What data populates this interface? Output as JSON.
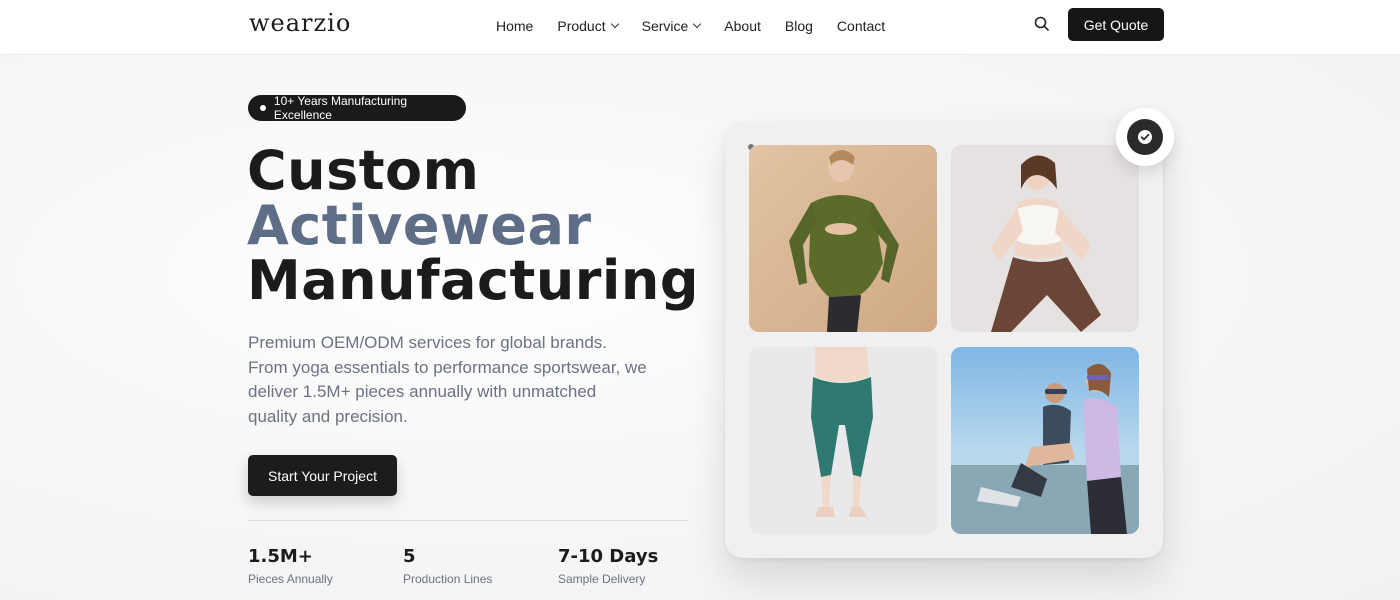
{
  "brand": {
    "logo_text": "wearzio"
  },
  "nav": {
    "items": [
      {
        "label": "Home",
        "has_dropdown": false
      },
      {
        "label": "Product",
        "has_dropdown": true
      },
      {
        "label": "Service",
        "has_dropdown": true
      },
      {
        "label": "About",
        "has_dropdown": false
      },
      {
        "label": "Blog",
        "has_dropdown": false
      },
      {
        "label": "Contact",
        "has_dropdown": false
      }
    ],
    "search_icon": "search-icon",
    "cta_label": "Get Quote"
  },
  "hero": {
    "badge": "10+ Years Manufacturing Excellence",
    "headline": {
      "line1": "Custom",
      "line2": "Activewear",
      "line3": "Manufacturing"
    },
    "description": "Premium OEM/ODM services for global brands. From yoga essentials to performance sportswear, we deliver 1.5M+ pieces annually with unmatched quality and precision.",
    "cta_label": "Start Your Project",
    "stats": [
      {
        "value": "1.5M+",
        "label": "Pieces Annually"
      },
      {
        "value": "5",
        "label": "Production Lines"
      },
      {
        "value": "7-10 Days",
        "label": "Sample Delivery"
      }
    ]
  },
  "gallery": {
    "photos": [
      {
        "name": "photo-green-top"
      },
      {
        "name": "photo-white-bra"
      },
      {
        "name": "photo-teal-leggings"
      },
      {
        "name": "photo-couple-stretch"
      }
    ],
    "badge_icon": "check-circle-icon"
  },
  "colors": {
    "primary_dark": "#161616",
    "headline_accent": "#5e6e86",
    "text_muted": "#6b7280"
  }
}
